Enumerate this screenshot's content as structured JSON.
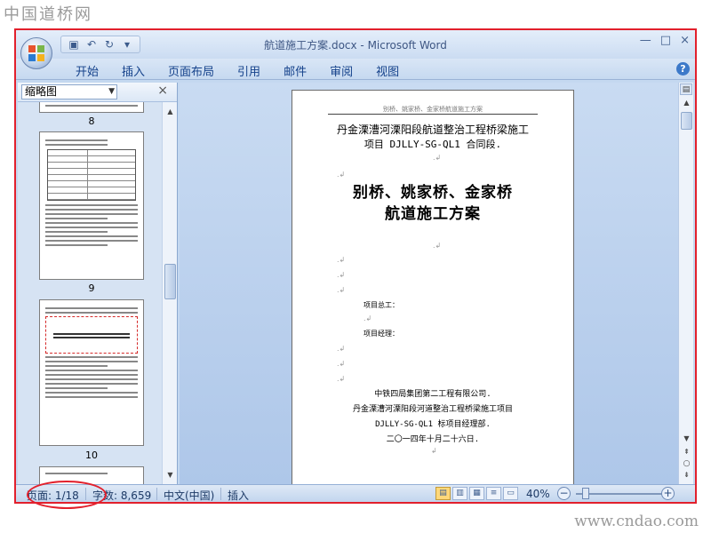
{
  "watermark": {
    "top": "中国道桥网",
    "bottom": "www.cndao.com"
  },
  "window": {
    "title": "航道施工方案.docx - Microsoft Word",
    "minimize": "—",
    "maximize": "□",
    "close": "×"
  },
  "qat": {
    "save": "▣",
    "undo": "↶",
    "redo": "↻",
    "customize": "▾"
  },
  "ribbon_tabs": [
    "开始",
    "插入",
    "页面布局",
    "引用",
    "邮件",
    "审阅",
    "视图"
  ],
  "help": "?",
  "thumbnail_pane": {
    "view_select": "缩略图",
    "close": "×",
    "pages": [
      "8",
      "9",
      "10"
    ]
  },
  "document": {
    "header_text": "别桥、姚家桥、金家桥航道施工方案",
    "project_line1": "丹金溧漕河溧阳段航道整治工程桥梁施工",
    "project_line2": "项目 DJLLY-SG-QL1 合同段.",
    "title_line1": "别桥、姚家桥、金家桥",
    "title_line2": "航道施工方案",
    "field_chief_engineer": "项目总工：",
    "field_manager": "项目经理：",
    "org_line1": "中铁四局集团第二工程有限公司.",
    "org_line2": "丹金溧漕河溧阳段河道整治工程桥梁施工项目",
    "org_line3": "DJLLY-SG-QL1 标项目经理部.",
    "date": "二〇一四年十月二十六日."
  },
  "status": {
    "page": "页面: 1/18",
    "words": "字数: 8,659",
    "language": "中文(中国)",
    "mode": "插入",
    "zoom": "40%",
    "zoom_minus": "−",
    "zoom_plus": "+"
  },
  "colors": {
    "highlight": "#e2202c",
    "ribbon_text": "#15428b"
  }
}
